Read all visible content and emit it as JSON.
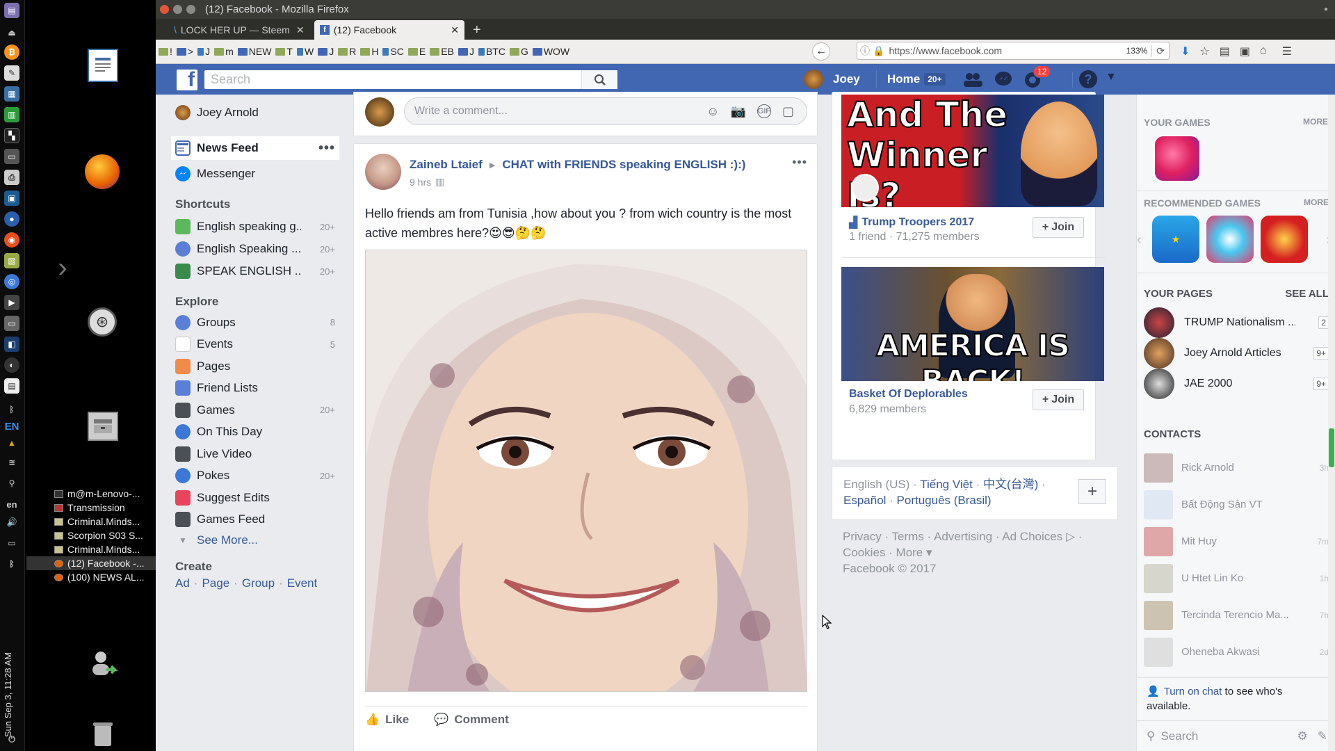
{
  "window": {
    "title": "(12) Facebook - Mozilla Firefox"
  },
  "tabs": [
    {
      "label": "LOCK HER UP — Steem",
      "active": false
    },
    {
      "label": "(12) Facebook",
      "active": true
    }
  ],
  "bookmarks": [
    "!",
    ">",
    "J",
    "m",
    "NEW",
    "T",
    "W",
    "J",
    "R",
    "H",
    "SC",
    "E",
    "EB",
    "J",
    "BTC",
    "G",
    "WOW"
  ],
  "url": {
    "value": "https://www.facebook.com",
    "zoom": "133%"
  },
  "desktop": {
    "window_list": [
      "m@m-Lenovo-...",
      "Transmission",
      "Criminal.Minds...",
      "Scorpion S03 S...",
      "Criminal.Minds...",
      "(12) Facebook -...",
      "(100) NEWS AL..."
    ],
    "keyboard": "EN",
    "keyboard_small": "en",
    "clock": "Sun Sep 3, 11:28 AM"
  },
  "fb": {
    "search_placeholder": "Search",
    "user": "Joey",
    "home_label": "Home",
    "home_badge": "20+",
    "notif_count": "12",
    "colors": {
      "blue": "#4267b2",
      "link": "#365899",
      "badge": "#fa3e3e"
    }
  },
  "leftnav": {
    "profile": "Joey Arnold",
    "news_feed": "News Feed",
    "messenger": "Messenger",
    "shortcuts_title": "Shortcuts",
    "shortcuts": [
      {
        "label": "English speaking g...",
        "count": "20+"
      },
      {
        "label": "English Speaking ...",
        "count": "20+"
      },
      {
        "label": "SPEAK ENGLISH ...",
        "count": "20+"
      }
    ],
    "explore_title": "Explore",
    "explore": [
      {
        "label": "Groups",
        "count": "8",
        "icon": "groups-icon"
      },
      {
        "label": "Events",
        "count": "5",
        "icon": "calendar-icon"
      },
      {
        "label": "Pages",
        "count": "",
        "icon": "flag-icon"
      },
      {
        "label": "Friend Lists",
        "count": "",
        "icon": "friend-list-icon"
      },
      {
        "label": "Games",
        "count": "20+",
        "icon": "games-icon"
      },
      {
        "label": "On This Day",
        "count": "",
        "icon": "clock-icon"
      },
      {
        "label": "Live Video",
        "count": "",
        "icon": "video-camera-icon"
      },
      {
        "label": "Pokes",
        "count": "20+",
        "icon": "poke-icon"
      },
      {
        "label": "Suggest Edits",
        "count": "",
        "icon": "map-pin-icon"
      },
      {
        "label": "Games Feed",
        "count": "",
        "icon": "gamepad-icon"
      }
    ],
    "see_more": "See More...",
    "create_title": "Create",
    "create_links": [
      "Ad",
      "Page",
      "Group",
      "Event"
    ]
  },
  "feed": {
    "comment_placeholder": "Write a comment...",
    "post": {
      "author": "Zaineb Ltaief",
      "group": "CHAT with FRIENDS speaking ENGLISH :):)",
      "time": "9 hrs",
      "text": "Hello friends am from Tunisia ,how about you ? from wich country is the most active membres here?😍😎🤔🤔",
      "like": "Like",
      "comment": "Comment"
    }
  },
  "ads": {
    "group1": {
      "image_text": "And The Winner Is?",
      "name": "Trump Troopers 2017",
      "meta": "1 friend · 71,275 members",
      "join": "Join"
    },
    "group2": {
      "image_text": "AMERICA IS BACK!",
      "name": "Basket Of Deplorables",
      "meta": "6,829 members",
      "join": "Join"
    },
    "languages": {
      "current": "English (US)",
      "others": [
        "Tiếng Việt",
        "中文(台灣)",
        "Español",
        "Português (Brasil)"
      ]
    },
    "footer": {
      "links": [
        "Privacy",
        "Terms",
        "Advertising",
        "Ad Choices",
        "Cookies",
        "More"
      ],
      "copyright": "Facebook © 2017"
    }
  },
  "rightcol": {
    "your_games": "YOUR GAMES",
    "more": "MORE",
    "recommended": "RECOMMENDED GAMES",
    "your_pages": "YOUR PAGES",
    "see_all": "SEE ALL",
    "pages": [
      {
        "name": "TRUMP Nationalism ...",
        "badge": "2"
      },
      {
        "name": "Joey Arnold Articles",
        "badge": "9+"
      },
      {
        "name": "JAE 2000",
        "badge": "9+"
      }
    ],
    "contacts_title": "CONTACTS",
    "contacts": [
      {
        "name": "Rick Arnold",
        "time": "3h"
      },
      {
        "name": "Bất Động Sản VT",
        "time": ""
      },
      {
        "name": "Mit Huy",
        "time": "7m"
      },
      {
        "name": "U Htet Lin Ko",
        "time": "1h"
      },
      {
        "name": "Tercinda Terencio Ma...",
        "time": "7h"
      },
      {
        "name": "Oheneba Akwasi",
        "time": "2d"
      }
    ],
    "chat_link": "Turn on chat",
    "chat_text": " to see who's available.",
    "chat_search": "Search"
  }
}
